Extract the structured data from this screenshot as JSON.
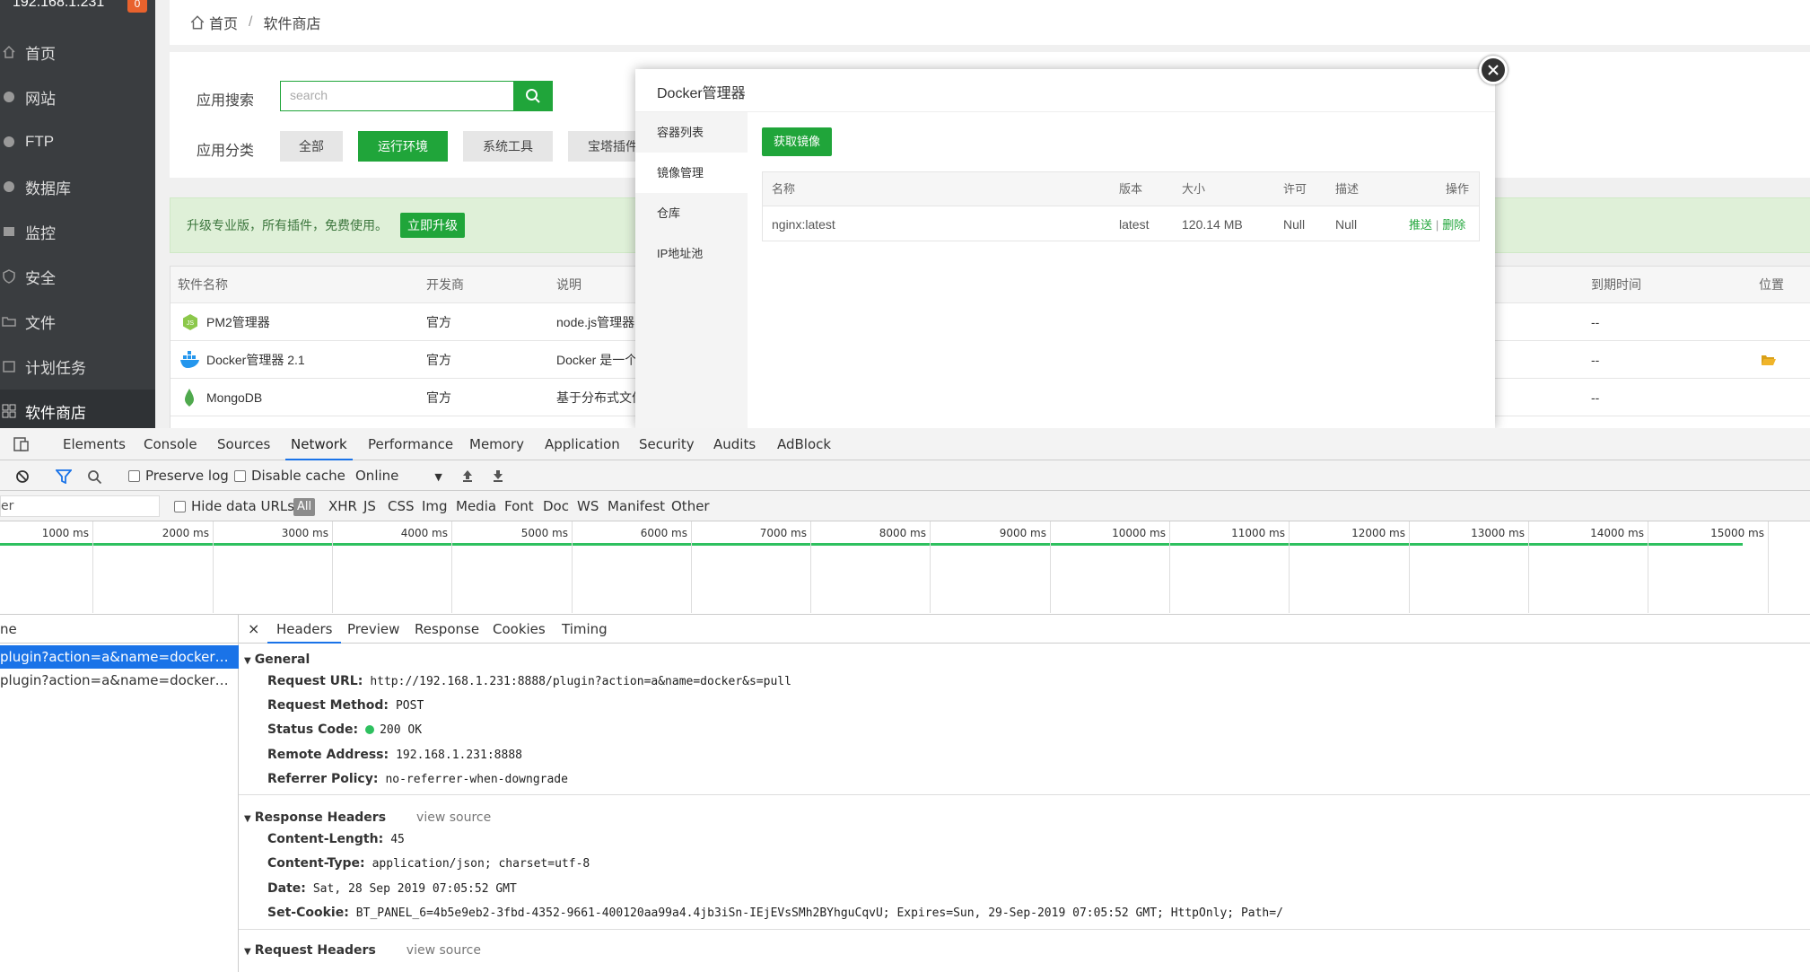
{
  "sidebar": {
    "ip": "192.168.1.231",
    "badge": "0",
    "items": [
      {
        "label": "首页",
        "icon": "home-icon"
      },
      {
        "label": "网站",
        "icon": "globe-icon"
      },
      {
        "label": "FTP",
        "icon": "ftp-icon"
      },
      {
        "label": "数据库",
        "icon": "database-icon"
      },
      {
        "label": "监控",
        "icon": "monitor-icon"
      },
      {
        "label": "安全",
        "icon": "shield-icon"
      },
      {
        "label": "文件",
        "icon": "folder-icon"
      },
      {
        "label": "计划任务",
        "icon": "schedule-icon"
      },
      {
        "label": "软件商店",
        "icon": "apps-icon"
      }
    ]
  },
  "breadcrumb": {
    "home": "首页",
    "sep": "/",
    "current": "软件商店"
  },
  "search": {
    "label": "应用搜索",
    "placeholder": "search"
  },
  "category": {
    "label": "应用分类",
    "items": [
      "全部",
      "运行环境",
      "系统工具",
      "宝塔插件"
    ]
  },
  "upgrade": {
    "text": "升级专业版，所有插件，免费使用。",
    "button": "立即升级"
  },
  "apptable": {
    "headers": [
      "软件名称",
      "开发商",
      "说明",
      "到期时间",
      "位置"
    ],
    "rows": [
      {
        "name": "PM2管理器",
        "dev": "官方",
        "desc": "node.js管理器",
        "expire": "--"
      },
      {
        "name": "Docker管理器 2.1",
        "dev": "官方",
        "desc": "Docker 是一个",
        "expire": "--"
      },
      {
        "name": "MongoDB",
        "dev": "官方",
        "desc": "基于分布式文件",
        "expire": "--"
      }
    ]
  },
  "modal": {
    "title": "Docker管理器",
    "tabs": [
      "容器列表",
      "镜像管理",
      "仓库",
      "IP地址池"
    ],
    "get_image": "获取镜像",
    "headers": [
      "名称",
      "版本",
      "大小",
      "许可",
      "描述",
      "操作"
    ],
    "row": {
      "name": "nginx:latest",
      "version": "latest",
      "size": "120.14 MB",
      "license": "Null",
      "desc": "Null",
      "push": "推送",
      "sep": "|",
      "delete": "删除"
    }
  },
  "devtools": {
    "tabs": [
      "Elements",
      "Console",
      "Sources",
      "Network",
      "Performance",
      "Memory",
      "Application",
      "Security",
      "Audits",
      "AdBlock"
    ],
    "active_tab": "Network",
    "preserve_log": "Preserve log",
    "disable_cache": "Disable cache",
    "throttle": "Online",
    "filter_placeholder": "er",
    "hide_data_urls": "Hide data URLs",
    "types": [
      "All",
      "XHR",
      "JS",
      "CSS",
      "Img",
      "Media",
      "Font",
      "Doc",
      "WS",
      "Manifest",
      "Other"
    ],
    "timeline": [
      "1000 ms",
      "2000 ms",
      "3000 ms",
      "4000 ms",
      "5000 ms",
      "6000 ms",
      "7000 ms",
      "8000 ms",
      "9000 ms",
      "10000 ms",
      "11000 ms",
      "12000 ms",
      "13000 ms",
      "14000 ms",
      "15000 ms"
    ],
    "list_header": "ne",
    "requests": [
      "plugin?action=a&name=docker&s=p...",
      "plugin?action=a&name=docker&s=G..."
    ],
    "detail_tabs": [
      "Headers",
      "Preview",
      "Response",
      "Cookies",
      "Timing"
    ],
    "general": {
      "title": "General",
      "request_url_k": "Request URL:",
      "request_url_v": "http://192.168.1.231:8888/plugin?action=a&name=docker&s=pull",
      "method_k": "Request Method:",
      "method_v": "POST",
      "status_k": "Status Code:",
      "status_v": "200 OK",
      "remote_k": "Remote Address:",
      "remote_v": "192.168.1.231:8888",
      "referrer_k": "Referrer Policy:",
      "referrer_v": "no-referrer-when-downgrade"
    },
    "response_headers": {
      "title": "Response Headers",
      "view_source": "view source",
      "cl_k": "Content-Length:",
      "cl_v": "45",
      "ct_k": "Content-Type:",
      "ct_v": "application/json; charset=utf-8",
      "date_k": "Date:",
      "date_v": "Sat, 28 Sep 2019 07:05:52 GMT",
      "cookie_k": "Set-Cookie:",
      "cookie_v": "BT_PANEL_6=4b5e9eb2-3fbd-4352-9661-400120aa99a4.4jb3iSn-IEjEVsSMh2BYhguCqvU; Expires=Sun, 29-Sep-2019 07:05:52 GMT; HttpOnly; Path=/"
    },
    "request_headers": {
      "title": "Request Headers",
      "view_source": "view source"
    }
  },
  "colors": {
    "brand": "#20a53a",
    "sidebar": "#3a3d40",
    "devtools_accent": "#1a73e8"
  }
}
